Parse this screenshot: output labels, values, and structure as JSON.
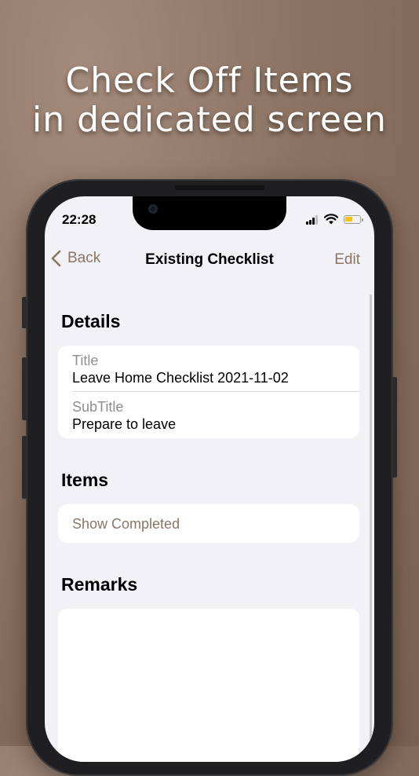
{
  "headline": {
    "line1": "Check Off Items",
    "line2": "in dedicated screen"
  },
  "status_bar": {
    "time": "22:28",
    "battery_color": "#f2c511"
  },
  "nav": {
    "back_label": "Back",
    "title": "Existing Checklist",
    "edit_label": "Edit",
    "accent_color": "#8a7566"
  },
  "details": {
    "header": "Details",
    "title_label": "Title",
    "title_value": "Leave Home Checklist 2021-11-02",
    "subtitle_label": "SubTitle",
    "subtitle_value": "Prepare to leave"
  },
  "items": {
    "header": "Items",
    "show_completed_label": "Show Completed"
  },
  "remarks": {
    "header": "Remarks",
    "value": ""
  }
}
